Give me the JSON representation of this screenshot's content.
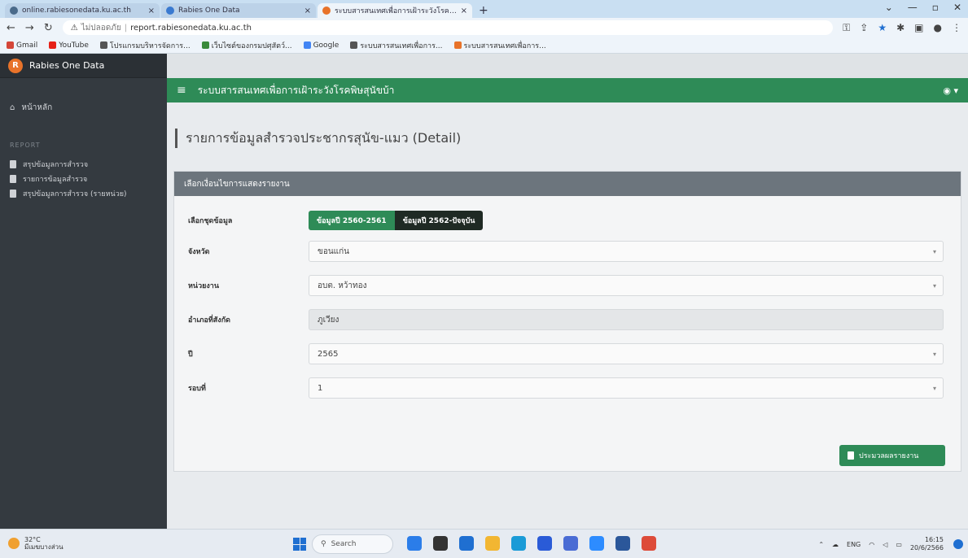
{
  "browser": {
    "tabs": [
      {
        "title": "online.rabiesonedata.ku.ac.th",
        "active": false,
        "fav_color": "#4a6a8a"
      },
      {
        "title": "Rabies One Data",
        "active": false,
        "fav_color": "#3a7ad0"
      },
      {
        "title": "ระบบสารสนเทศเพื่อการเฝ้าระวังโรคพิษสุนัขบ้า",
        "active": true,
        "fav_color": "#e8732a"
      }
    ],
    "new_tab": "+",
    "url_security": "ไม่ปลอดภัย",
    "url": "report.rabiesonedata.ku.ac.th",
    "bookmarks": [
      {
        "label": "Gmail",
        "color": "#d44638"
      },
      {
        "label": "YouTube",
        "color": "#e62117"
      },
      {
        "label": "โปรแกรมบริหารจัดการ...",
        "color": "#555555"
      },
      {
        "label": "เว็บไซต์ของกรมปศุสัตว์...",
        "color": "#3a8a3a"
      },
      {
        "label": "Google",
        "color": "#4285f4"
      },
      {
        "label": "ระบบสารสนเทศเพื่อการ...",
        "color": "#555555"
      },
      {
        "label": "ระบบสารสนเทศเพื่อการ...",
        "color": "#e8732a"
      }
    ]
  },
  "app": {
    "brand": "Rabies One Data",
    "header_title": "ระบบสารสนเทศเพื่อการเฝ้าระวังโรคพิษสุนัขบ้า",
    "user_icon": "user-circle-icon",
    "sidebar": {
      "home": "หน้าหลัก",
      "section": "REPORT",
      "items": [
        {
          "label": "สรุปข้อมูลการสำรวจ"
        },
        {
          "label": "รายการข้อมูลสำรวจ"
        },
        {
          "label": "สรุปข้อมูลการสำรวจ (รายหน่วย)"
        }
      ]
    },
    "page_title": "รายการข้อมูลสำรวจประชากรสุนัข-แมว (Detail)",
    "card_title": "เลือกเงื่อนไขการแสดงรายงาน",
    "form": {
      "dataset_label": "เลือกชุดข้อมูล",
      "dataset_options": [
        "ข้อมูลปี 2560-2561",
        "ข้อมูลปี 2562-ปัจจุบัน"
      ],
      "province_label": "จังหวัด",
      "province_value": "ขอนแก่น",
      "agency_label": "หน่วยงาน",
      "agency_value": "อบต. หว้าทอง",
      "district_label": "อำเภอที่สังกัด",
      "district_value": "ภูเวียง",
      "year_label": "ปี",
      "year_value": "2565",
      "round_label": "รอบที่",
      "round_value": "1"
    },
    "report_button": "ประมวลผลรายงาน"
  },
  "taskbar": {
    "weather_temp": "32°C",
    "weather_desc": "มีเมฆบางส่วน",
    "search_label": "Search",
    "lang": "ENG",
    "time": "16:15",
    "date": "20/6/2566"
  }
}
